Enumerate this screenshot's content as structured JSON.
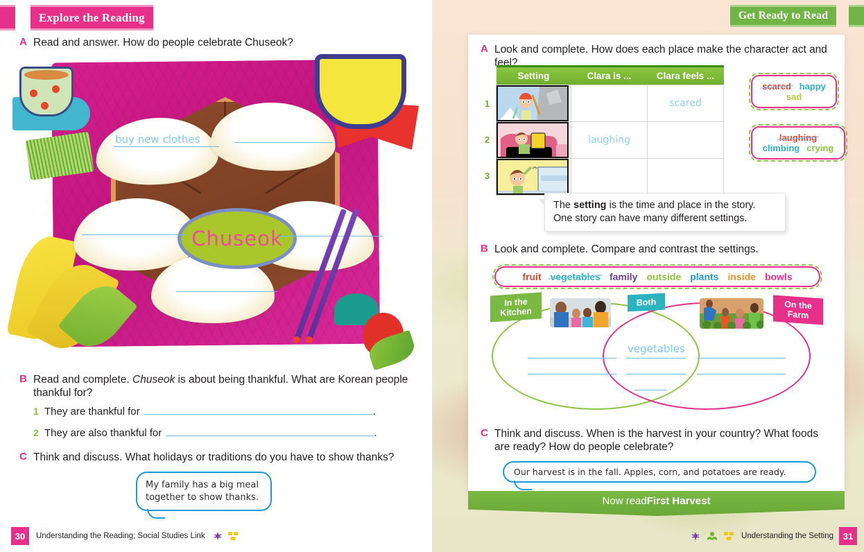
{
  "left_page": {
    "banner": "Explore the Reading",
    "section_a": {
      "letter": "A",
      "prompt": "Read and answer. How do people celebrate Chuseok?",
      "center_label": "Chuseok",
      "answers": [
        "buy new clothes",
        "",
        "",
        "",
        ""
      ]
    },
    "section_b": {
      "letter": "B",
      "prompt_part1": "Read and complete. ",
      "prompt_italic": "Chuseok",
      "prompt_part2": " is about being thankful. What are Korean people thankful for?",
      "items": [
        {
          "num": "1",
          "text": "They are thankful for",
          "answer": ""
        },
        {
          "num": "2",
          "text": "They are also thankful for",
          "answer": ""
        }
      ]
    },
    "section_c": {
      "letter": "C",
      "prompt": "Think and discuss. What holidays or traditions do you have to show thanks?",
      "bubble_line1": "My family has a big meal",
      "bubble_line2": "together to show thanks."
    },
    "footer": {
      "page": "30",
      "text": "Understanding the Reading; Social Studies Link",
      "icons": [
        "bug-icon",
        "blocks-icon"
      ]
    }
  },
  "right_page": {
    "banner": "Get Ready to Read",
    "section_a": {
      "letter": "A",
      "prompt": "Look and complete. How does each place make the character act and feel?",
      "table": {
        "headers": [
          "Setting",
          "Clara is ...",
          "Clara feels ..."
        ],
        "rows": [
          {
            "num": "1",
            "setting": "mountain-climbing-panel",
            "clara_is": "",
            "clara_feels": "scared"
          },
          {
            "num": "2",
            "setting": "sofa-reading-panel",
            "clara_is": "laughing",
            "clara_feels": ""
          },
          {
            "num": "3",
            "setting": "kitchen-window-panel",
            "clara_is": "",
            "clara_feels": ""
          }
        ]
      },
      "wordbox1": {
        "words": [
          "scared",
          "happy",
          "sad"
        ],
        "struck": "scared"
      },
      "wordbox2": {
        "words": [
          "laughing",
          "climbing",
          "crying"
        ],
        "struck": "laughing"
      }
    },
    "tip": {
      "line1_pre": "The ",
      "line1_bold": "setting",
      "line1_post": " is the time and place in the story.",
      "line2": "One story can have many different settings."
    },
    "section_b": {
      "letter": "B",
      "prompt": "Look and complete. Compare and contrast the settings.",
      "word_bank": [
        {
          "word": "fruit",
          "color": "#e8432f",
          "struck": false
        },
        {
          "word": "vegetables",
          "color": "#2bb3bf",
          "struck": true
        },
        {
          "word": "family",
          "color": "#6b3fa0",
          "struck": false
        },
        {
          "word": "outside",
          "color": "#8cc63f",
          "struck": false
        },
        {
          "word": "plants",
          "color": "#1e9ad6",
          "struck": false
        },
        {
          "word": "inside",
          "color": "#f0922b",
          "struck": false
        },
        {
          "word": "bowls",
          "color": "#e6308a",
          "struck": false
        }
      ],
      "venn": {
        "left_label": "In the\nKitchen",
        "center_label": "Both",
        "right_label": "On the\nFarm",
        "left_photo": "kitchen-family-photo",
        "right_photo": "farm-family-photo",
        "center_answer": "vegetables"
      }
    },
    "section_c": {
      "letter": "C",
      "prompt": "Think and discuss. When is the harvest in your country? What foods are ready? How do people celebrate?",
      "bubble": "Our harvest is in the fall. Apples, corn, and potatoes are ready."
    },
    "now_read_pre": "Now read ",
    "now_read_title": "First Harvest",
    "footer": {
      "page": "31",
      "text": "Understanding the Setting",
      "icons": [
        "bug-icon",
        "open-book-icon",
        "blocks-icon"
      ]
    }
  },
  "colors": {
    "pink": "#e6308a",
    "green": "#7ab942",
    "blue_hand": "#7fc7ef",
    "teal": "#2bb3bf"
  }
}
